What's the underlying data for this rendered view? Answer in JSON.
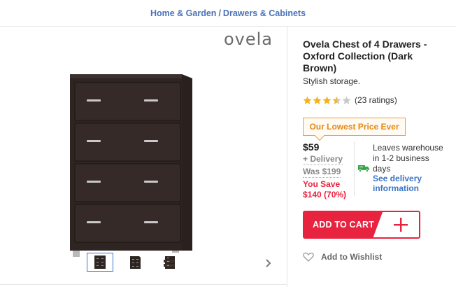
{
  "breadcrumb": {
    "items": [
      "Home & Garden",
      "Drawers & Cabinets"
    ],
    "separator": "/"
  },
  "gallery": {
    "brand": "ovela",
    "main_image": "dark-brown-chest-of-4-drawers",
    "thumbnails": [
      "chest-front-view",
      "chest-angle-view",
      "chest-open-view"
    ],
    "active_thumbnail": 0,
    "next_icon": "chevron-right-icon"
  },
  "product": {
    "title": "Ovela Chest of 4 Drawers - Oxford Collection (Dark Brown)",
    "subtitle": "Stylish storage.",
    "rating": 3.5,
    "rating_max": 5,
    "ratings_text": "(23 ratings)"
  },
  "pricing": {
    "badge": "Our Lowest Price Ever",
    "price": "$59",
    "delivery": "+ Delivery",
    "was": "Was $199",
    "save_line1": "You Save",
    "save_line2": "$140 (70%)"
  },
  "shipping": {
    "text": "Leaves warehouse in 1-2 business days",
    "link": "See delivery information",
    "icon": "delivery-truck-icon"
  },
  "actions": {
    "add_to_cart": "ADD TO CART",
    "wishlist": "Add to Wishlist"
  },
  "colors": {
    "accent_red": "#e8233f",
    "link_blue": "#4a72b8",
    "badge_orange": "#e28a16",
    "star_gold": "#f0b41c"
  }
}
